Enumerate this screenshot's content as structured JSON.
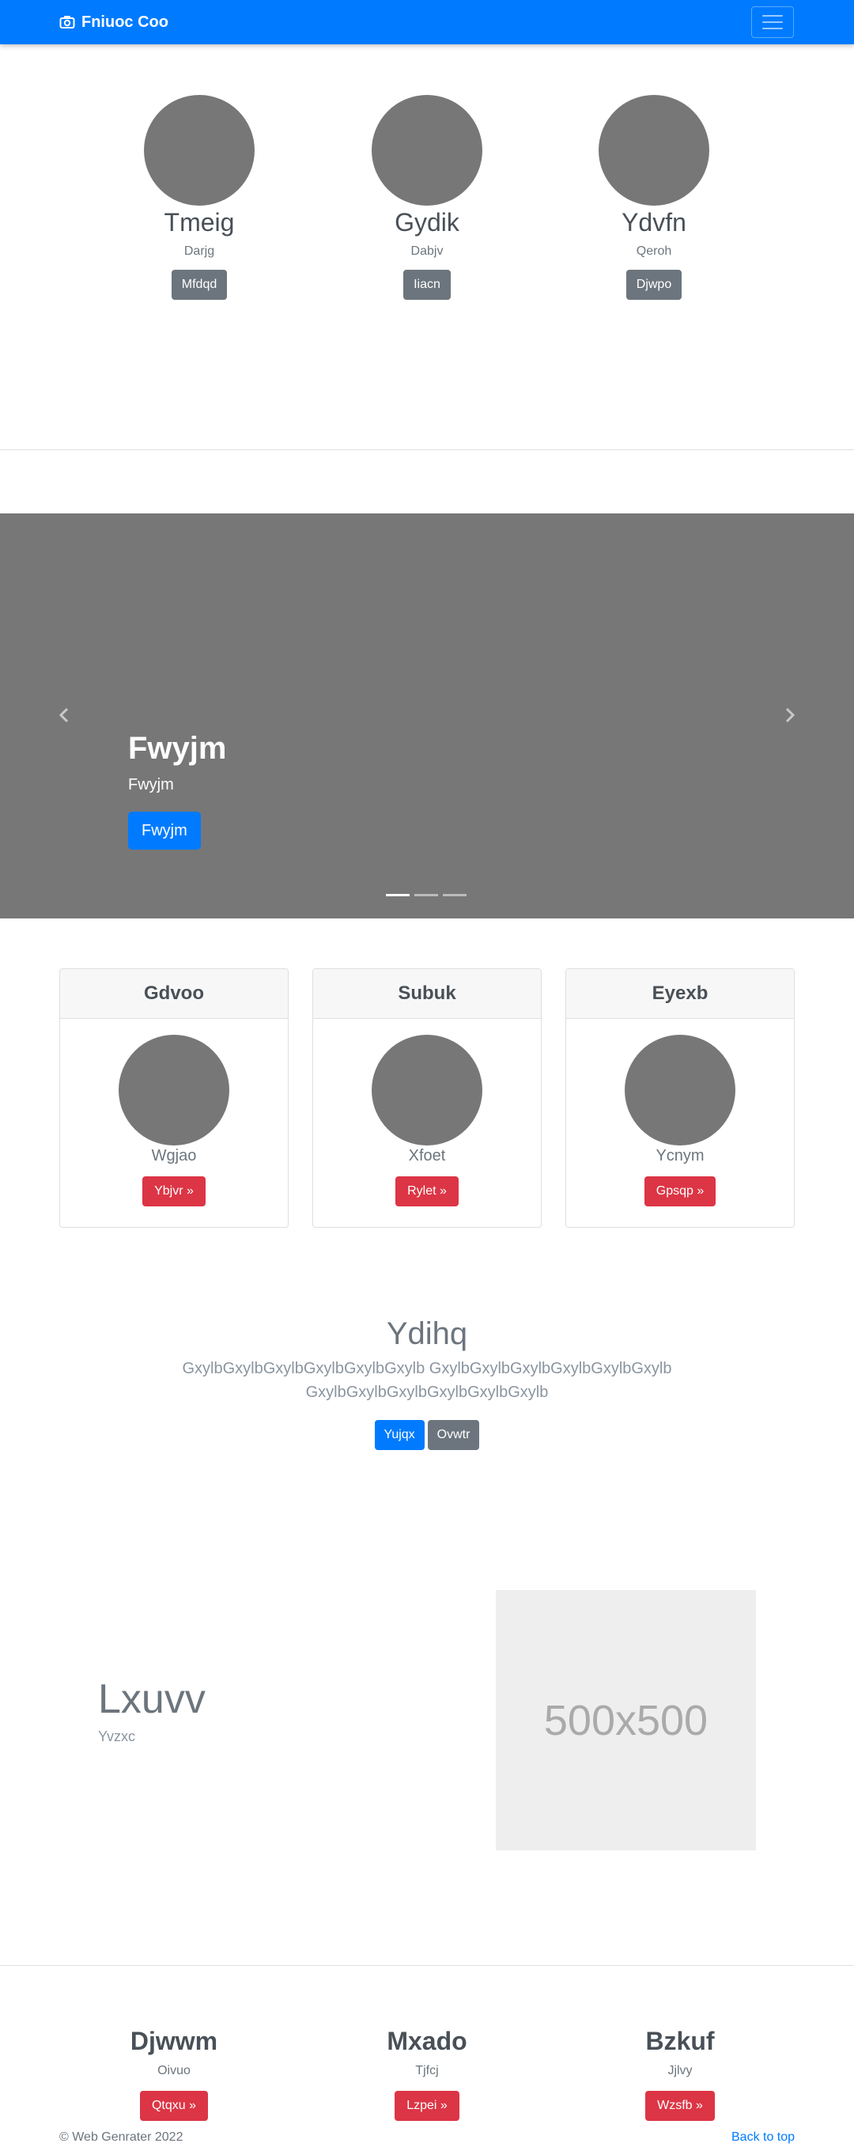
{
  "navbar": {
    "brand": "Fniuoc Coo",
    "brand_icon": "camera-icon",
    "toggle_icon": "hamburger-icon"
  },
  "team": [
    {
      "name": "Tmeig",
      "sub": "Darjg",
      "button": "Mfdqd"
    },
    {
      "name": "Gydik",
      "sub": "Dabjv",
      "button": "Iiacn"
    },
    {
      "name": "Ydvfn",
      "sub": "Qeroh",
      "button": "Djwpo"
    }
  ],
  "carousel": {
    "title": "Fwyjm",
    "text": "Fwyjm",
    "button": "Fwyjm",
    "prev_icon": "chevron-left-icon",
    "next_icon": "chevron-right-icon",
    "slide_count": 3,
    "active_slide": 1
  },
  "cards": [
    {
      "header": "Gdvoo",
      "text": "Wgjao",
      "button": "Ybjvr »"
    },
    {
      "header": "Subuk",
      "text": "Xfoet",
      "button": "Rylet »"
    },
    {
      "header": "Eyexb",
      "text": "Ycnym",
      "button": "Gpsqp »"
    }
  ],
  "jumbotron": {
    "title": "Ydihq",
    "text": "GxylbGxylbGxylbGxylbGxylbGxylb GxylbGxylbGxylbGxylbGxylbGxylb GxylbGxylbGxylbGxylbGxylbGxylb",
    "primary_button": "Yujqx",
    "secondary_button": "Ovwtr"
  },
  "feature": {
    "title": "Lxuvv",
    "subtitle": "Yvzxc",
    "image_label": "500x500"
  },
  "bottom": [
    {
      "title": "Djwwm",
      "sub": "Oivuo",
      "button": "Qtqxu »"
    },
    {
      "title": "Mxado",
      "sub": "Tjfcj",
      "button": "Lzpei »"
    },
    {
      "title": "Bzkuf",
      "sub": "Jjlvy",
      "button": "Wzsfb »"
    }
  ],
  "footer": {
    "copyright": "© Web Genrater 2022",
    "back_to_top": "Back to top"
  },
  "colors": {
    "primary": "#007bff",
    "secondary": "#6c757d",
    "danger": "#dc3545",
    "placeholder": "#777777"
  }
}
